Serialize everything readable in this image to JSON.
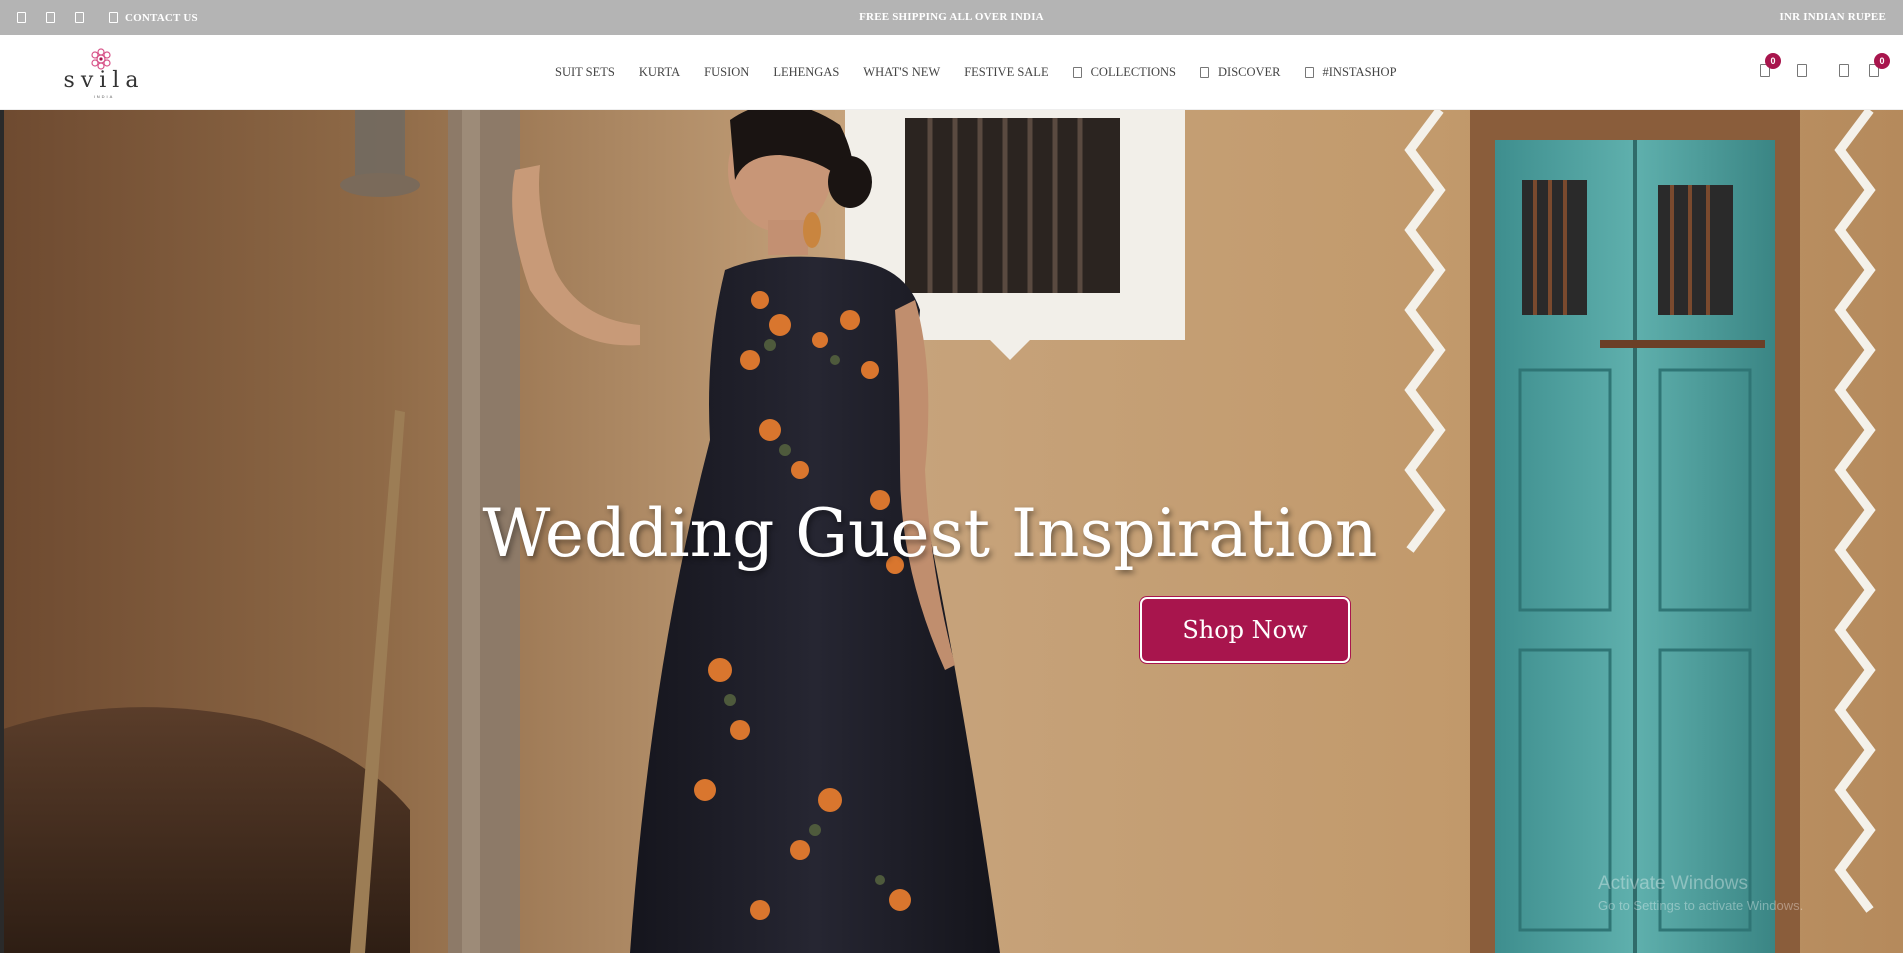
{
  "topbar": {
    "icons": [
      "facebook-icon",
      "instagram-icon",
      "pinterest-icon"
    ],
    "contact_label": "CONTACT US",
    "shipping_message": "FREE SHIPPING ALL OVER INDIA",
    "currency_label": "INR  INDIAN RUPEE"
  },
  "logo": {
    "text": "svila",
    "subtext": "INDIA"
  },
  "nav": {
    "items": [
      {
        "label": "SUIT SETS"
      },
      {
        "label": "KURTA"
      },
      {
        "label": "FUSION"
      },
      {
        "label": "LEHENGAS"
      },
      {
        "label": "WHAT'S NEW"
      },
      {
        "label": "FESTIVE SALE"
      },
      {
        "label": "COLLECTIONS",
        "icon": "collections-icon"
      },
      {
        "label": "DISCOVER",
        "icon": "discover-icon"
      },
      {
        "label": "#INSTASHOP",
        "icon": "instagram-icon"
      }
    ]
  },
  "actions": {
    "wishlist_count": "0",
    "cart_count": "0"
  },
  "hero": {
    "title": "Wedding Guest Inspiration",
    "cta_label": "Shop Now"
  },
  "watermark": {
    "line1": "Activate Windows",
    "line2": "Go to Settings to activate Windows."
  },
  "colors": {
    "accent": "#a8154d",
    "topbar": "#b4b4b4"
  }
}
